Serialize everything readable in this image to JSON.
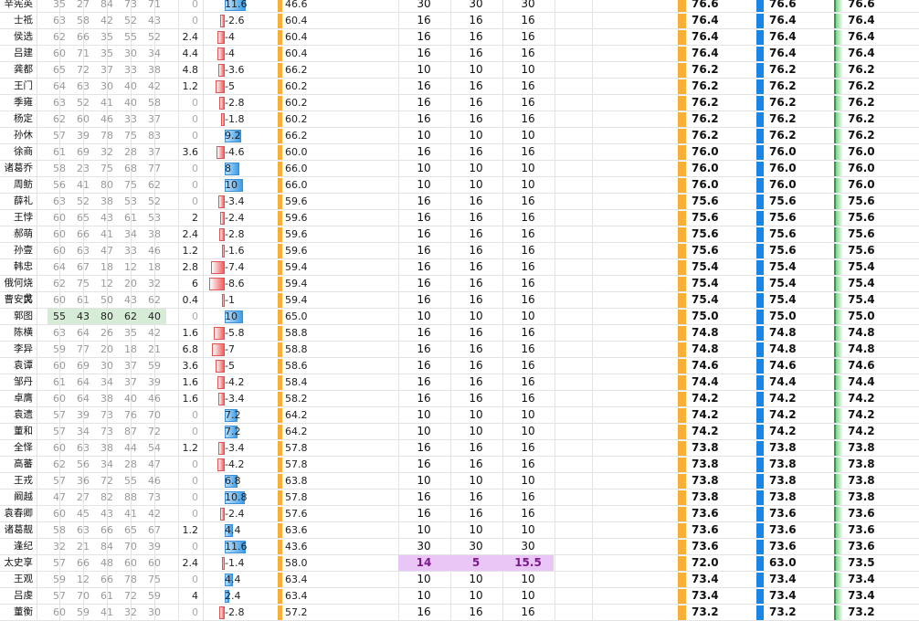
{
  "colors": {
    "negative_bar": "#f25d5d",
    "positive_bar": "#3d9ee8",
    "overall_bar": "#f7b035",
    "score_gold": "#f7b035",
    "score_blue": "#1a84e8",
    "score_green": "#2e9e44",
    "highlight_row": "#e9c6f5",
    "highlight_stat": "#d6ecd7"
  },
  "rows": [
    {
      "name": "辛宪英",
      "s": [
        "35",
        "27",
        "84",
        "73",
        "71"
      ],
      "d": "0",
      "dir": "11.6",
      "ov": "46.6",
      "a": "30",
      "b": "30",
      "c": "30",
      "x": "76.6",
      "y": "76.6",
      "z": "76.6"
    },
    {
      "name": "士祗",
      "s": [
        "63",
        "58",
        "42",
        "52",
        "43"
      ],
      "d": "0",
      "dir": "-2.6",
      "ov": "60.4",
      "a": "16",
      "b": "16",
      "c": "16",
      "x": "76.4",
      "y": "76.4",
      "z": "76.4"
    },
    {
      "name": "侯选",
      "s": [
        "62",
        "66",
        "35",
        "55",
        "52"
      ],
      "d": "2.4",
      "dir": "-4",
      "ov": "60.4",
      "a": "16",
      "b": "16",
      "c": "16",
      "x": "76.4",
      "y": "76.4",
      "z": "76.4"
    },
    {
      "name": "吕建",
      "s": [
        "60",
        "71",
        "35",
        "30",
        "34"
      ],
      "d": "4.4",
      "dir": "-4",
      "ov": "60.4",
      "a": "16",
      "b": "16",
      "c": "16",
      "x": "76.4",
      "y": "76.4",
      "z": "76.4"
    },
    {
      "name": "龚都",
      "s": [
        "65",
        "72",
        "37",
        "33",
        "38"
      ],
      "d": "4.8",
      "dir": "-3.6",
      "ov": "66.2",
      "a": "10",
      "b": "10",
      "c": "10",
      "x": "76.2",
      "y": "76.2",
      "z": "76.2"
    },
    {
      "name": "王门",
      "s": [
        "64",
        "63",
        "30",
        "40",
        "42"
      ],
      "d": "1.2",
      "dir": "-5",
      "ov": "60.2",
      "a": "16",
      "b": "16",
      "c": "16",
      "x": "76.2",
      "y": "76.2",
      "z": "76.2"
    },
    {
      "name": "季雍",
      "s": [
        "63",
        "52",
        "41",
        "40",
        "58"
      ],
      "d": "0",
      "dir": "-2.8",
      "ov": "60.2",
      "a": "16",
      "b": "16",
      "c": "16",
      "x": "76.2",
      "y": "76.2",
      "z": "76.2"
    },
    {
      "name": "杨定",
      "s": [
        "62",
        "60",
        "46",
        "33",
        "37"
      ],
      "d": "0",
      "dir": "-1.8",
      "ov": "60.2",
      "a": "16",
      "b": "16",
      "c": "16",
      "x": "76.2",
      "y": "76.2",
      "z": "76.2"
    },
    {
      "name": "孙休",
      "s": [
        "57",
        "39",
        "78",
        "75",
        "83"
      ],
      "d": "0",
      "dir": "9.2",
      "ov": "66.2",
      "a": "10",
      "b": "10",
      "c": "10",
      "x": "76.2",
      "y": "76.2",
      "z": "76.2"
    },
    {
      "name": "徐商",
      "s": [
        "61",
        "69",
        "32",
        "28",
        "37"
      ],
      "d": "3.6",
      "dir": "-4.6",
      "ov": "60.0",
      "a": "16",
      "b": "16",
      "c": "16",
      "x": "76.0",
      "y": "76.0",
      "z": "76.0"
    },
    {
      "name": "诸葛乔",
      "s": [
        "58",
        "23",
        "75",
        "68",
        "77"
      ],
      "d": "0",
      "dir": "8",
      "ov": "66.0",
      "a": "10",
      "b": "10",
      "c": "10",
      "x": "76.0",
      "y": "76.0",
      "z": "76.0"
    },
    {
      "name": "周鲂",
      "s": [
        "56",
        "41",
        "80",
        "75",
        "62"
      ],
      "d": "0",
      "dir": "10",
      "ov": "66.0",
      "a": "10",
      "b": "10",
      "c": "10",
      "x": "76.0",
      "y": "76.0",
      "z": "76.0"
    },
    {
      "name": "薛礼",
      "s": [
        "63",
        "52",
        "38",
        "53",
        "52"
      ],
      "d": "0",
      "dir": "-3.4",
      "ov": "59.6",
      "a": "16",
      "b": "16",
      "c": "16",
      "x": "75.6",
      "y": "75.6",
      "z": "75.6"
    },
    {
      "name": "王悖",
      "s": [
        "60",
        "65",
        "43",
        "61",
        "53"
      ],
      "d": "2",
      "dir": "-2.4",
      "ov": "59.6",
      "a": "16",
      "b": "16",
      "c": "16",
      "x": "75.6",
      "y": "75.6",
      "z": "75.6"
    },
    {
      "name": "郝萌",
      "s": [
        "60",
        "66",
        "41",
        "34",
        "38"
      ],
      "d": "2.4",
      "dir": "-2.8",
      "ov": "59.6",
      "a": "16",
      "b": "16",
      "c": "16",
      "x": "75.6",
      "y": "75.6",
      "z": "75.6"
    },
    {
      "name": "孙壹",
      "s": [
        "60",
        "63",
        "47",
        "33",
        "46"
      ],
      "d": "1.2",
      "dir": "-1.6",
      "ov": "59.6",
      "a": "16",
      "b": "16",
      "c": "16",
      "x": "75.6",
      "y": "75.6",
      "z": "75.6"
    },
    {
      "name": "韩忠",
      "s": [
        "64",
        "67",
        "18",
        "12",
        "18"
      ],
      "d": "2.8",
      "dir": "-7.4",
      "ov": "59.4",
      "a": "16",
      "b": "16",
      "c": "16",
      "x": "75.4",
      "y": "75.4",
      "z": "75.4"
    },
    {
      "name": "俄何烧戈",
      "s": [
        "62",
        "75",
        "12",
        "20",
        "32"
      ],
      "d": "6",
      "dir": "-8.6",
      "ov": "59.4",
      "a": "16",
      "b": "16",
      "c": "16",
      "x": "75.4",
      "y": "75.4",
      "z": "75.4"
    },
    {
      "name": "曹安民",
      "s": [
        "60",
        "61",
        "50",
        "43",
        "62"
      ],
      "d": "0.4",
      "dir": "-1",
      "ov": "59.4",
      "a": "16",
      "b": "16",
      "c": "16",
      "x": "75.4",
      "y": "75.4",
      "z": "75.4"
    },
    {
      "name": "郭图",
      "s": [
        "55",
        "43",
        "80",
        "62",
        "40"
      ],
      "d": "0",
      "dir": "10",
      "ov": "65.0",
      "a": "10",
      "b": "10",
      "c": "10",
      "x": "75.0",
      "y": "75.0",
      "z": "75.0",
      "hl": true
    },
    {
      "name": "陈横",
      "s": [
        "63",
        "64",
        "26",
        "35",
        "42"
      ],
      "d": "1.6",
      "dir": "-5.8",
      "ov": "58.8",
      "a": "16",
      "b": "16",
      "c": "16",
      "x": "74.8",
      "y": "74.8",
      "z": "74.8"
    },
    {
      "name": "李异",
      "s": [
        "59",
        "77",
        "20",
        "18",
        "21"
      ],
      "d": "6.8",
      "dir": "-7",
      "ov": "58.8",
      "a": "16",
      "b": "16",
      "c": "16",
      "x": "74.8",
      "y": "74.8",
      "z": "74.8"
    },
    {
      "name": "袁谭",
      "s": [
        "60",
        "69",
        "30",
        "37",
        "59"
      ],
      "d": "3.6",
      "dir": "-5",
      "ov": "58.6",
      "a": "16",
      "b": "16",
      "c": "16",
      "x": "74.6",
      "y": "74.6",
      "z": "74.6"
    },
    {
      "name": "邹丹",
      "s": [
        "61",
        "64",
        "34",
        "37",
        "39"
      ],
      "d": "1.6",
      "dir": "-4.2",
      "ov": "58.4",
      "a": "16",
      "b": "16",
      "c": "16",
      "x": "74.4",
      "y": "74.4",
      "z": "74.4"
    },
    {
      "name": "卓膺",
      "s": [
        "60",
        "64",
        "38",
        "40",
        "46"
      ],
      "d": "1.6",
      "dir": "-3.4",
      "ov": "58.2",
      "a": "16",
      "b": "16",
      "c": "16",
      "x": "74.2",
      "y": "74.2",
      "z": "74.2"
    },
    {
      "name": "袁遗",
      "s": [
        "57",
        "39",
        "73",
        "76",
        "70"
      ],
      "d": "0",
      "dir": "7.2",
      "ov": "64.2",
      "a": "10",
      "b": "10",
      "c": "10",
      "x": "74.2",
      "y": "74.2",
      "z": "74.2"
    },
    {
      "name": "董和",
      "s": [
        "57",
        "34",
        "73",
        "87",
        "72"
      ],
      "d": "0",
      "dir": "7.2",
      "ov": "64.2",
      "a": "10",
      "b": "10",
      "c": "10",
      "x": "74.2",
      "y": "74.2",
      "z": "74.2"
    },
    {
      "name": "全怿",
      "s": [
        "60",
        "63",
        "38",
        "44",
        "54"
      ],
      "d": "1.2",
      "dir": "-3.4",
      "ov": "57.8",
      "a": "16",
      "b": "16",
      "c": "16",
      "x": "73.8",
      "y": "73.8",
      "z": "73.8"
    },
    {
      "name": "高蕃",
      "s": [
        "62",
        "56",
        "34",
        "28",
        "47"
      ],
      "d": "0",
      "dir": "-4.2",
      "ov": "57.8",
      "a": "16",
      "b": "16",
      "c": "16",
      "x": "73.8",
      "y": "73.8",
      "z": "73.8"
    },
    {
      "name": "王戎",
      "s": [
        "57",
        "36",
        "72",
        "55",
        "46"
      ],
      "d": "0",
      "dir": "6.8",
      "ov": "63.8",
      "a": "10",
      "b": "10",
      "c": "10",
      "x": "73.8",
      "y": "73.8",
      "z": "73.8"
    },
    {
      "name": "阚越",
      "s": [
        "47",
        "27",
        "82",
        "88",
        "73"
      ],
      "d": "0",
      "dir": "10.8",
      "ov": "57.8",
      "a": "16",
      "b": "16",
      "c": "16",
      "x": "73.8",
      "y": "73.8",
      "z": "73.8"
    },
    {
      "name": "袁春卿",
      "s": [
        "60",
        "45",
        "43",
        "41",
        "42"
      ],
      "d": "0",
      "dir": "-2.4",
      "ov": "57.6",
      "a": "16",
      "b": "16",
      "c": "16",
      "x": "73.6",
      "y": "73.6",
      "z": "73.6"
    },
    {
      "name": "诸葛靓",
      "s": [
        "58",
        "63",
        "66",
        "65",
        "67"
      ],
      "d": "1.2",
      "dir": "4.4",
      "ov": "63.6",
      "a": "10",
      "b": "10",
      "c": "10",
      "x": "73.6",
      "y": "73.6",
      "z": "73.6"
    },
    {
      "name": "逢纪",
      "s": [
        "32",
        "21",
        "84",
        "70",
        "39"
      ],
      "d": "0",
      "dir": "11.6",
      "ov": "43.6",
      "a": "30",
      "b": "30",
      "c": "30",
      "x": "73.6",
      "y": "73.6",
      "z": "73.6"
    },
    {
      "name": "太史享",
      "s": [
        "57",
        "66",
        "48",
        "60",
        "60"
      ],
      "d": "2.4",
      "dir": "-1.4",
      "ov": "58.0",
      "a": "14",
      "b": "5",
      "c": "15.5",
      "x": "72.0",
      "y": "63.0",
      "z": "73.5",
      "special": true
    },
    {
      "name": "王观",
      "s": [
        "59",
        "12",
        "66",
        "78",
        "75"
      ],
      "d": "0",
      "dir": "4.4",
      "ov": "63.4",
      "a": "10",
      "b": "10",
      "c": "10",
      "x": "73.4",
      "y": "73.4",
      "z": "73.4"
    },
    {
      "name": "吕虔",
      "s": [
        "57",
        "70",
        "61",
        "72",
        "59"
      ],
      "d": "4",
      "dir": "2.4",
      "ov": "63.4",
      "a": "10",
      "b": "10",
      "c": "10",
      "x": "73.4",
      "y": "73.4",
      "z": "73.4"
    },
    {
      "name": "董衡",
      "s": [
        "60",
        "59",
        "41",
        "32",
        "30"
      ],
      "d": "0",
      "dir": "-2.8",
      "ov": "57.2",
      "a": "16",
      "b": "16",
      "c": "16",
      "x": "73.2",
      "y": "73.2",
      "z": "73.2"
    }
  ]
}
